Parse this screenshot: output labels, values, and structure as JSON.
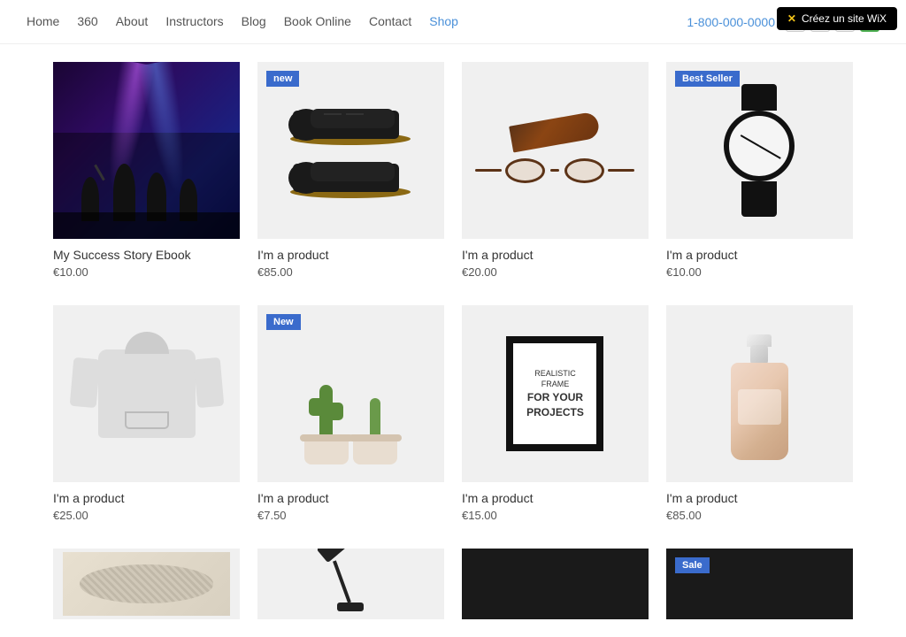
{
  "wix_banner": {
    "label": "Créez un site WiX"
  },
  "nav": {
    "links": [
      {
        "id": "home",
        "label": "Home",
        "active": false
      },
      {
        "id": "360",
        "label": "360",
        "active": false
      },
      {
        "id": "about",
        "label": "About",
        "active": false
      },
      {
        "id": "instructors",
        "label": "Instructors",
        "active": false
      },
      {
        "id": "blog",
        "label": "Blog",
        "active": false
      },
      {
        "id": "book-online",
        "label": "Book Online",
        "active": false
      },
      {
        "id": "contact",
        "label": "Contact",
        "active": false
      },
      {
        "id": "shop",
        "label": "Shop",
        "active": true
      }
    ],
    "phone": "1-800-000-0000"
  },
  "products": [
    {
      "id": "p1",
      "name": "My Success Story Ebook",
      "price": "€10.00",
      "badge": "",
      "image_type": "ebook"
    },
    {
      "id": "p2",
      "name": "I'm a product",
      "price": "€85.00",
      "badge": "new",
      "image_type": "shoes"
    },
    {
      "id": "p3",
      "name": "I'm a product",
      "price": "€20.00",
      "badge": "",
      "image_type": "glasses"
    },
    {
      "id": "p4",
      "name": "I'm a product",
      "price": "€10.00",
      "badge": "Best Seller",
      "image_type": "watch"
    },
    {
      "id": "p5",
      "name": "I'm a product",
      "price": "€25.00",
      "badge": "",
      "image_type": "hoodie"
    },
    {
      "id": "p6",
      "name": "I'm a product",
      "price": "€7.50",
      "badge": "New",
      "image_type": "cactus"
    },
    {
      "id": "p7",
      "name": "I'm a product",
      "price": "€15.00",
      "badge": "",
      "image_type": "frame"
    },
    {
      "id": "p8",
      "name": "I'm a product",
      "price": "€85.00",
      "badge": "",
      "image_type": "perfume"
    }
  ],
  "bottom_row": [
    {
      "id": "b1",
      "image_type": "knit",
      "badge": ""
    },
    {
      "id": "b2",
      "image_type": "lamp",
      "badge": ""
    },
    {
      "id": "b3",
      "image_type": "dark",
      "badge": ""
    },
    {
      "id": "b4",
      "image_type": "dark",
      "badge": "Sale"
    }
  ],
  "frame_text": {
    "line1": "REALISTIC FRAME",
    "line2": "FOR YOUR",
    "line3": "PROJECTS"
  }
}
